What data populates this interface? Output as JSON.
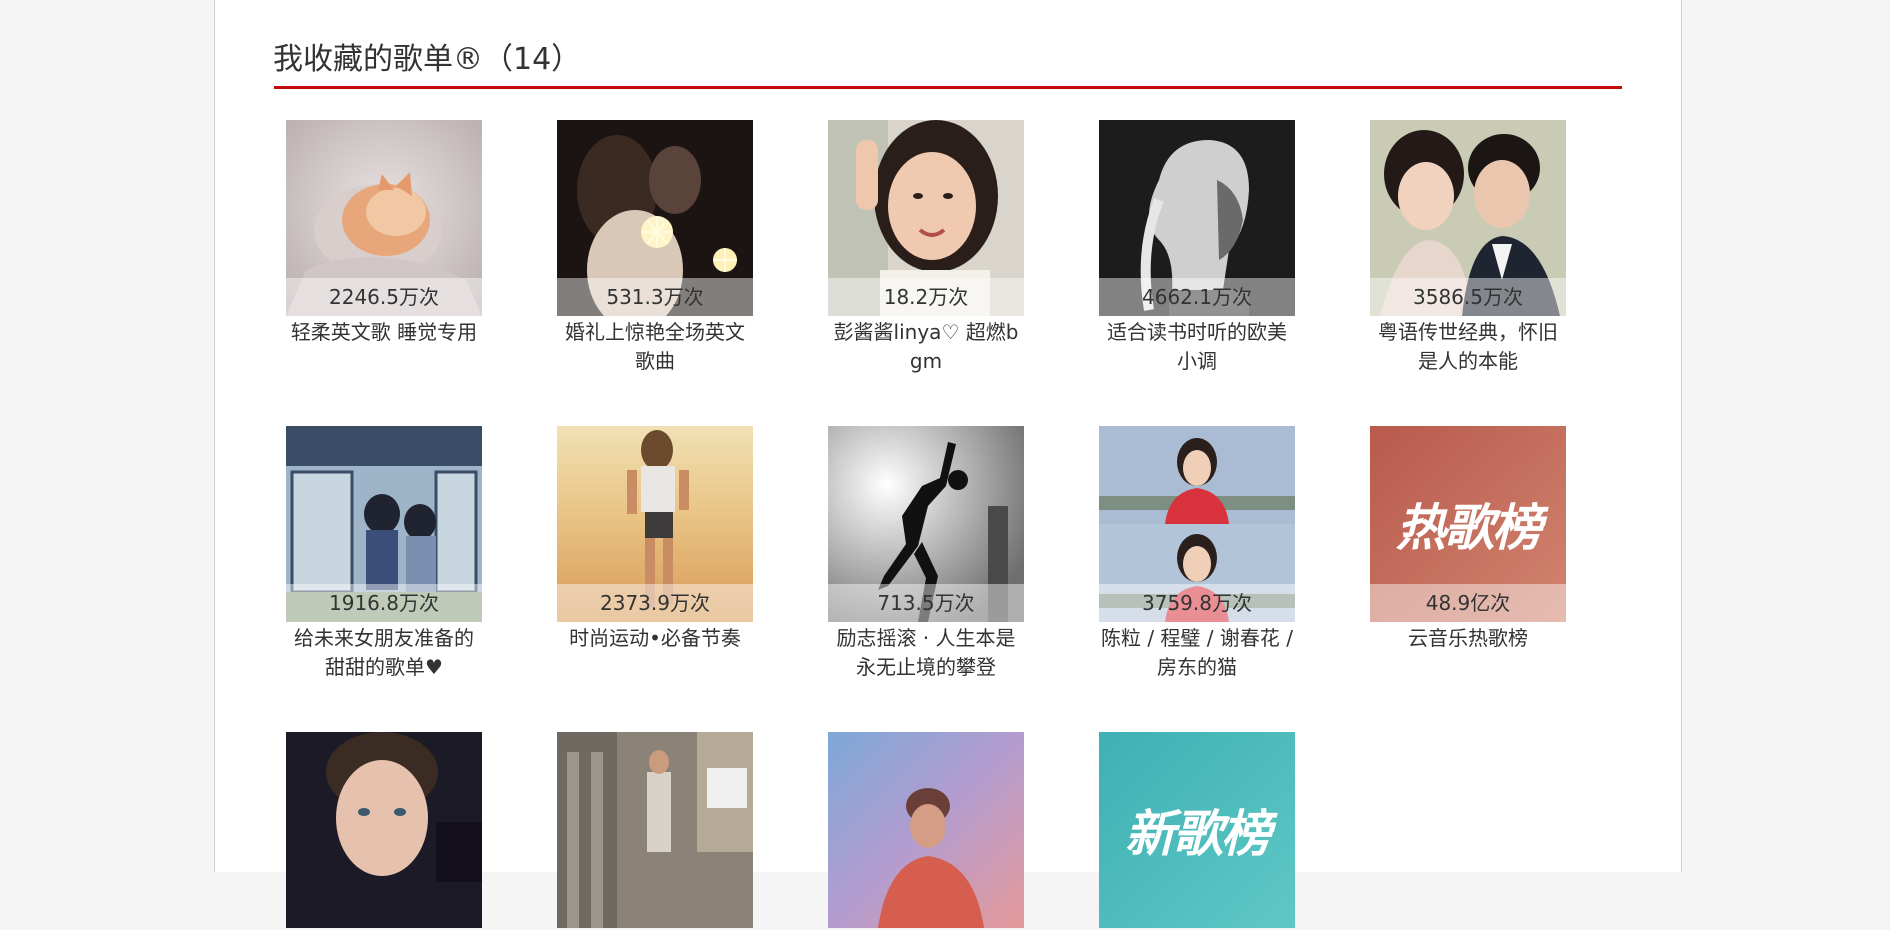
{
  "section": {
    "title": "我收藏的歌单®（14）"
  },
  "playlists": [
    {
      "play_count": "2246.5万次",
      "name": "轻柔英文歌 睡觉专用",
      "cover": "kitten-photo"
    },
    {
      "play_count": "531.3万次",
      "name": "婚礼上惊艳全场英文歌曲",
      "cover": "wedding-sparklers-photo"
    },
    {
      "play_count": "18.2万次",
      "name": "彭酱酱linya♡ 超燃bgm",
      "cover": "girl-selfie-photo"
    },
    {
      "play_count": "4662.1万次",
      "name": "适合读书时听的欧美小调",
      "cover": "bw-woman-profile-photo"
    },
    {
      "play_count": "3586.5万次",
      "name": "粤语传世经典，怀旧是人的本能",
      "cover": "couple-photo"
    },
    {
      "play_count": "1916.8万次",
      "name": "给未来女朋友准备的甜甜的歌单♥",
      "cover": "illustrated-couple"
    },
    {
      "play_count": "2373.9万次",
      "name": "时尚运动•必备节奏",
      "cover": "beach-runner-photo"
    },
    {
      "play_count": "713.5万次",
      "name": "励志摇滚 · 人生本是永无止境的攀登",
      "cover": "dancer-silhouette-photo"
    },
    {
      "play_count": "3759.8万次",
      "name": "陈粒 / 程璧 / 谢春花 / 房东的猫",
      "cover": "split-portrait-photo"
    },
    {
      "play_count": "48.9亿次",
      "name": "云音乐热歌榜",
      "cover": "hot-chart-banner",
      "brand": "热歌榜"
    },
    {
      "play_count": "",
      "name": "",
      "cover": "young-man-portrait"
    },
    {
      "play_count": "",
      "name": "",
      "cover": "street-photo"
    },
    {
      "play_count": "",
      "name": "",
      "cover": "colorful-portrait"
    },
    {
      "play_count": "",
      "name": "",
      "cover": "new-chart-banner",
      "brand": "新歌榜"
    }
  ]
}
